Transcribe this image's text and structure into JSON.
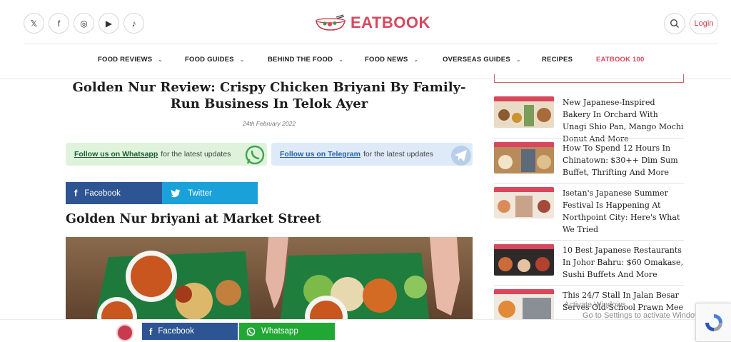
{
  "header": {
    "socials": [
      {
        "icon": "x-icon",
        "glyph": "𝕏"
      },
      {
        "icon": "facebook-icon",
        "glyph": "f"
      },
      {
        "icon": "instagram-icon",
        "glyph": "◎"
      },
      {
        "icon": "youtube-icon",
        "glyph": "▶"
      },
      {
        "icon": "tiktok-icon",
        "glyph": "♪"
      }
    ],
    "brand": "EATBOOK",
    "login_label": "Login",
    "nav": [
      {
        "label": "FOOD REVIEWS",
        "has_dropdown": true
      },
      {
        "label": "FOOD GUIDES",
        "has_dropdown": true
      },
      {
        "label": "BEHIND THE FOOD",
        "has_dropdown": true
      },
      {
        "label": "FOOD NEWS",
        "has_dropdown": true
      },
      {
        "label": "OVERSEAS GUIDES",
        "has_dropdown": true
      },
      {
        "label": "RECIPES",
        "has_dropdown": false
      },
      {
        "label": "EATBOOK 100",
        "has_dropdown": false
      }
    ]
  },
  "article": {
    "title": "Golden Nur Review: Crispy Chicken Briyani By Family-Run Business In Telok Ayer",
    "date": "24th February 2022",
    "follow_whatsapp": {
      "link": "Follow us on Whatsapp",
      "text": "for the latest updates"
    },
    "follow_telegram": {
      "link": "Follow us on Telegram",
      "text": "for the latest updates"
    },
    "share_facebook": "Facebook",
    "share_twitter": "Twitter",
    "subheading": "Golden Nur briyani at Market Street"
  },
  "sidebar": {
    "items": [
      {
        "title": "New Japanese-Inspired Bakery In Orchard With Unagi Shio Pan, Mango Mochi Donut And More"
      },
      {
        "title": "How To Spend 12 Hours In Chinatown: $30++ Dim Sum Buffet, Thrifting And More"
      },
      {
        "title": "Isetan's Japanese Summer Festival Is Happening At Northpoint City: Here's What We Tried"
      },
      {
        "title": "10 Best Japanese Restaurants In Johor Bahru: $60 Omakase, Sushi Buffets And More"
      },
      {
        "title": "This 24/7 Stall In Jalan Besar Serves Old-School Prawn Mee"
      }
    ]
  },
  "bottom_bar": {
    "facebook": "Facebook",
    "whatsapp": "Whatsapp"
  },
  "os_overlay": {
    "line1": "Activate Windows",
    "line2": "Go to Settings to activate Windows."
  },
  "colors": {
    "brand": "#d9475d",
    "facebook": "#2e5593",
    "twitter": "#1aa1d9",
    "whatsapp": "#21a834",
    "whatsapp_banner": "#dff3dc",
    "telegram_banner": "#dfeaf8"
  }
}
